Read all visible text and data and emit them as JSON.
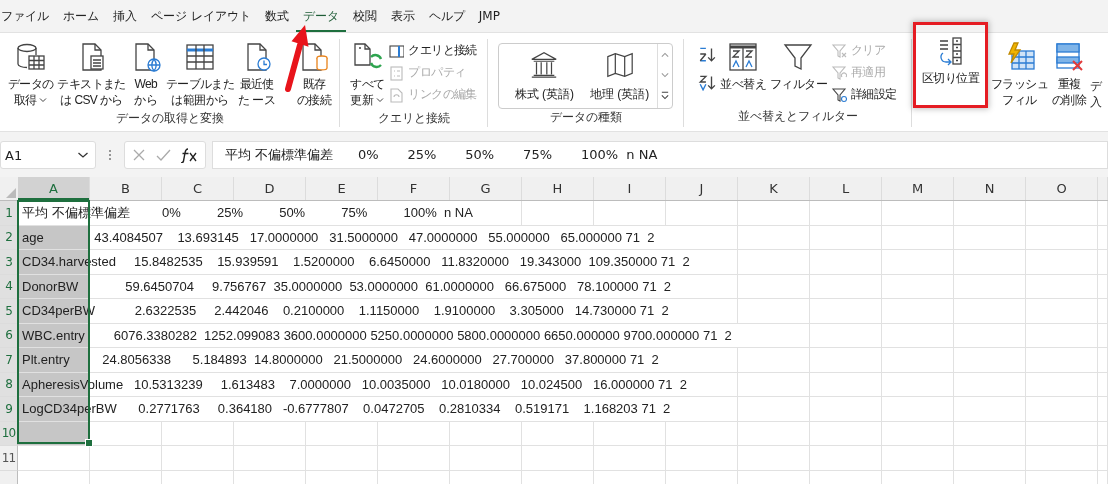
{
  "tabs": [
    {
      "label": "ファイル",
      "selected": false
    },
    {
      "label": "ホーム",
      "selected": false
    },
    {
      "label": "挿入",
      "selected": false
    },
    {
      "label": "ページ レイアウト",
      "selected": false
    },
    {
      "label": "数式",
      "selected": false
    },
    {
      "label": "データ",
      "selected": true
    },
    {
      "label": "校閲",
      "selected": false
    },
    {
      "label": "表示",
      "selected": false
    },
    {
      "label": "ヘルプ",
      "selected": false
    },
    {
      "label": "JMP",
      "selected": false
    }
  ],
  "ribbon": {
    "groups": [
      {
        "label": "データの取得と変換",
        "items": [
          {
            "kind": "large",
            "lines": [
              "データの",
              "取得"
            ],
            "dropdown": true,
            "disabled": false,
            "highlighted": false
          },
          {
            "kind": "large",
            "lines": [
              "テキストまた",
              "は CSV から"
            ],
            "dropdown": false,
            "disabled": false,
            "highlighted": false
          },
          {
            "kind": "large",
            "lines": [
              "Web",
              "から"
            ],
            "dropdown": false,
            "disabled": false,
            "highlighted": false
          },
          {
            "kind": "large",
            "lines": [
              "テーブルまた",
              "は範囲から"
            ],
            "dropdown": false,
            "disabled": false,
            "highlighted": false
          },
          {
            "kind": "large",
            "lines": [
              "最近使",
              "た ース"
            ],
            "dropdown": false,
            "disabled": false,
            "highlighted": false
          },
          {
            "kind": "large",
            "lines": [
              "既存",
              "の接続"
            ],
            "dropdown": false,
            "disabled": false,
            "highlighted": false
          }
        ]
      },
      {
        "label": "クエリと接続",
        "items": [
          {
            "kind": "large",
            "lines": [
              "すべて",
              "更新"
            ],
            "dropdown": true,
            "disabled": false,
            "highlighted": false
          },
          {
            "kind": "stack",
            "entries": [
              {
                "label": "クエリと接続",
                "disabled": false
              },
              {
                "label": "プロパティ",
                "disabled": true
              },
              {
                "label": "リンクの編集",
                "disabled": true
              }
            ]
          }
        ]
      },
      {
        "label": "データの種類",
        "items": [
          {
            "kind": "gallery",
            "entries": [
              {
                "label": "株式 (英語)"
              },
              {
                "label": "地理 (英語)"
              }
            ]
          }
        ]
      },
      {
        "label": "並べ替えとフィルター",
        "items": [
          {
            "kind": "sort_pair"
          },
          {
            "kind": "large",
            "lines": [
              "並べ替え"
            ],
            "dropdown": false,
            "disabled": false,
            "highlighted": false
          },
          {
            "kind": "large",
            "lines": [
              "フィルター"
            ],
            "dropdown": false,
            "disabled": false,
            "highlighted": false
          },
          {
            "kind": "stack",
            "entries": [
              {
                "label": "クリア",
                "disabled": true
              },
              {
                "label": "再適用",
                "disabled": true
              },
              {
                "label": "詳細設定",
                "disabled": false
              }
            ]
          }
        ]
      },
      {
        "items": [
          {
            "kind": "large",
            "lines": [
              "区切り位置"
            ],
            "dropdown": false,
            "disabled": false,
            "highlighted": true
          },
          {
            "kind": "large",
            "lines": [
              "フラッシュ",
              "フィル"
            ],
            "dropdown": false,
            "disabled": false,
            "highlighted": false
          },
          {
            "kind": "large",
            "lines": [
              "重複",
              "の削除"
            ],
            "dropdown": false,
            "disabled": false,
            "highlighted": false
          },
          {
            "kind": "cut",
            "lines": [
              "デ",
              "入"
            ]
          }
        ]
      }
    ]
  },
  "formula_bar": {
    "name_box": "A1",
    "formula": "平均 不偏標準偏差      0%       25%       50%       75%       100%  n NA"
  },
  "sheet": {
    "columns": [
      {
        "label": "A",
        "selected": true
      },
      {
        "label": "B",
        "selected": false
      },
      {
        "label": "C",
        "selected": false
      },
      {
        "label": "D",
        "selected": false
      },
      {
        "label": "E",
        "selected": false
      },
      {
        "label": "F",
        "selected": false
      },
      {
        "label": "G",
        "selected": false
      },
      {
        "label": "H",
        "selected": false
      },
      {
        "label": "I",
        "selected": false
      },
      {
        "label": "J",
        "selected": false
      },
      {
        "label": "K",
        "selected": false
      },
      {
        "label": "L",
        "selected": false
      },
      {
        "label": "M",
        "selected": false
      },
      {
        "label": "N",
        "selected": false
      },
      {
        "label": "O",
        "selected": false
      }
    ],
    "rows": [
      {
        "number": "1",
        "selected": true,
        "text": "平均 不偏標準偏差         0%          25%          50%          75%          100%  n NA"
      },
      {
        "number": "2",
        "selected": true,
        "text": "age              43.4084507    13.693145   17.0000000   31.5000000   47.0000000   55.000000   65.000000 71  2"
      },
      {
        "number": "3",
        "selected": true,
        "text": "CD34.harvested     15.8482535    15.939591    1.5200000    6.6450000   11.8320000   19.343000  109.350000 71  2"
      },
      {
        "number": "4",
        "selected": true,
        "text": "DonorBW             59.6450704     9.756767  35.0000000  53.0000000  61.0000000   66.675000   78.100000 71  2"
      },
      {
        "number": "5",
        "selected": true,
        "text": "CD34perBW           2.6322535     2.442046    0.2100000    1.1150000    1.9100000    3.305000   14.730000 71  2"
      },
      {
        "number": "6",
        "selected": true,
        "text": "WBC.entry        6076.3380282  1252.099083 3600.0000000 5250.0000000 5800.0000000 6650.000000 9700.000000 71  2"
      },
      {
        "number": "7",
        "selected": true,
        "text": "Plt.entry         24.8056338      5.184893  14.8000000   21.5000000   24.6000000   27.700000   37.800000 71  2"
      },
      {
        "number": "8",
        "selected": true,
        "text": "ApheresisVolume   10.5313239     1.613483    7.0000000   10.0035000   10.0180000   10.024500   16.000000 71  2"
      },
      {
        "number": "9",
        "selected": true,
        "text": "LogCD34perBW      0.2771763     0.364180   -0.6777807    0.0472705    0.2810334    0.519171    1.168203 71  2"
      },
      {
        "number": "10",
        "selected": true
      },
      {
        "number": "11",
        "selected": false
      },
      {
        "selected": false
      }
    ]
  }
}
